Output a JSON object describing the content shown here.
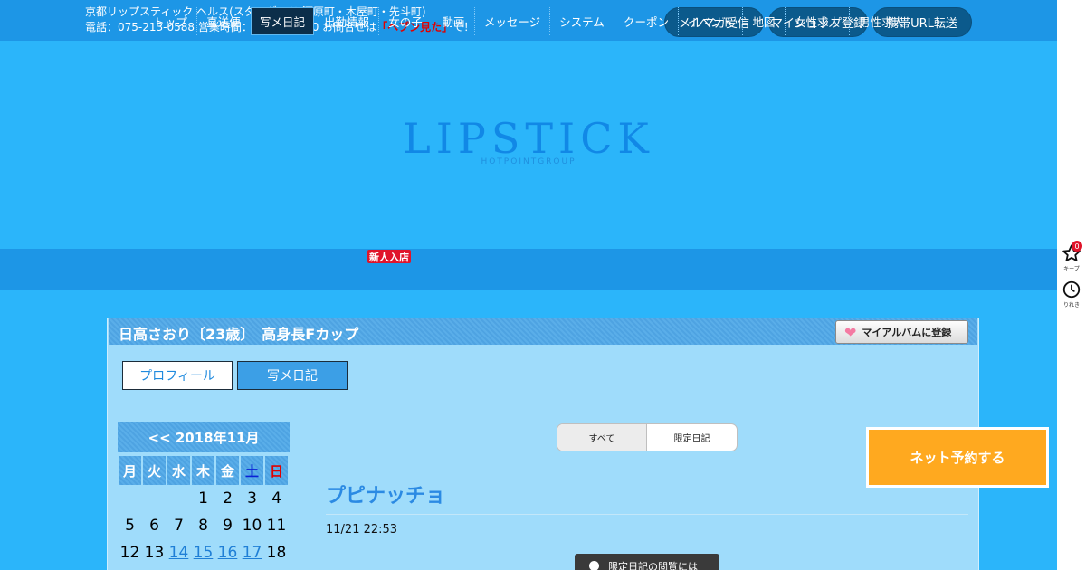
{
  "topbar": {
    "line1": "京都リップスティック ヘルス(スタンダード/河原町・木屋町・先斗町)",
    "line2_prefix": "電話：075-213-0588 営業時間：6:00～24:00 お問合せは",
    "line2_highlight": "「ヘブン見た」",
    "line2_suffix": "で！",
    "buttons": [
      "メルマガ受信",
      "マイショップ登録",
      "携帯URL転送"
    ]
  },
  "logo": {
    "main": "LIPSTICK",
    "sub": "HOTPOINTGROUP"
  },
  "nav": {
    "items": [
      "トップ",
      "直送便",
      "写メ日記",
      "出勤情報",
      "女の子",
      "動画",
      "メッセージ",
      "システム",
      "クーポン",
      "イベント",
      "地図",
      "女性求人",
      "男性求人"
    ],
    "active": "写メ日記",
    "new_badge": "新人入店"
  },
  "profile": {
    "title": "日高さおり〔23歳〕　高身長Fカップ",
    "album_button": "マイアルバムに登録",
    "tabs": [
      "プロフィール",
      "写メ日記"
    ]
  },
  "calendar": {
    "header": "<< 2018年11月",
    "weekdays": [
      "月",
      "火",
      "水",
      "木",
      "金",
      "土",
      "日"
    ],
    "row1": [
      "",
      "",
      "",
      "1",
      "2",
      "3",
      "4"
    ],
    "row2": [
      "5",
      "6",
      "7",
      "8",
      "9",
      "10",
      "11"
    ],
    "row3": [
      "12",
      "13",
      "14",
      "15",
      "16",
      "17",
      "18"
    ]
  },
  "filter": {
    "all": "すべて",
    "limited": "限定日記"
  },
  "post": {
    "title": "プピナッチョ",
    "date": "11/21 22:53",
    "locked_text": "限定日記の閲覧には"
  },
  "reserve_button": "ネット予約する",
  "rail": {
    "keep_label": "キープ",
    "keep_count": "0",
    "history_label": "りれき"
  },
  "colors": {
    "background": "#2bb5fa",
    "bar": "#1d96e6",
    "accent": "#ffa91f",
    "panel": "#9fdcfb"
  }
}
